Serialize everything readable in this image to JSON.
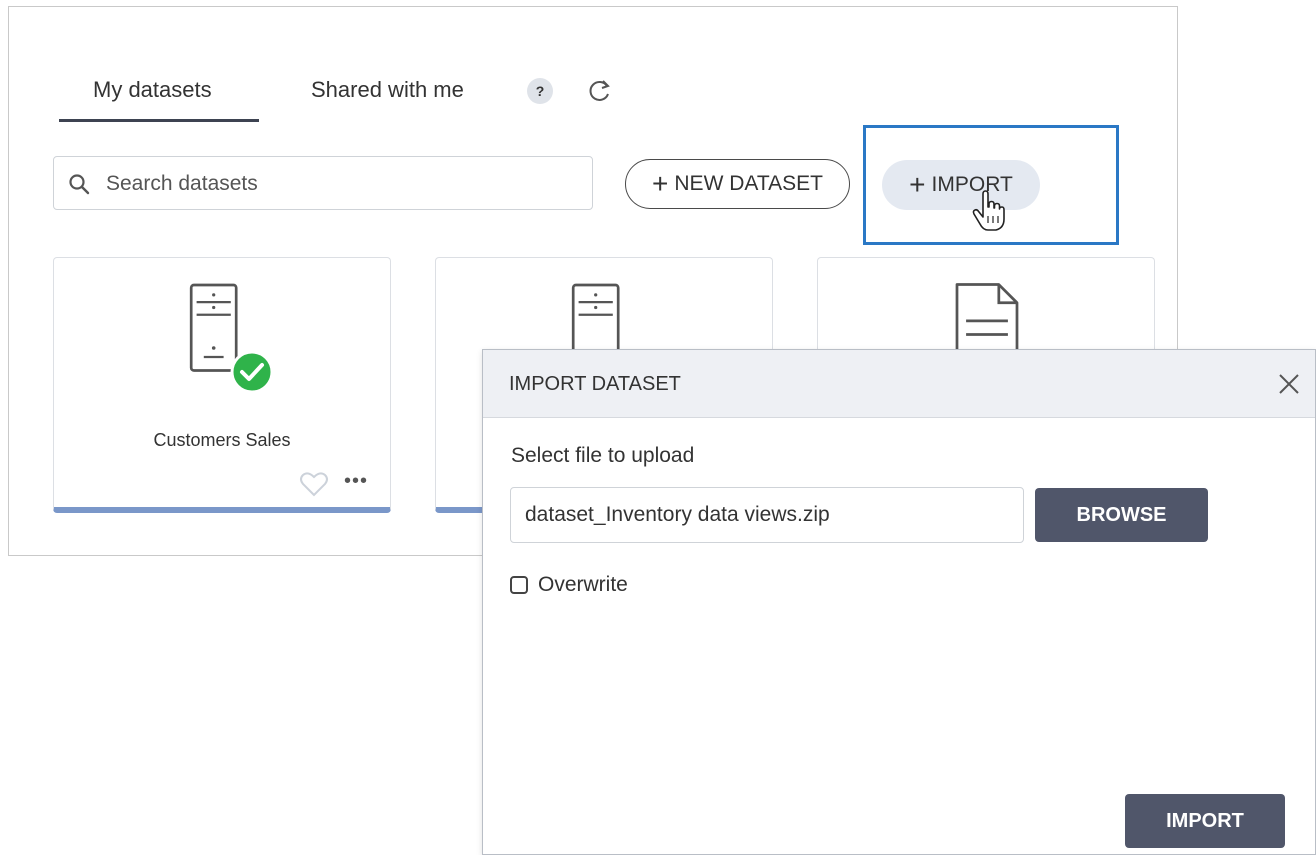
{
  "tabs": {
    "my_datasets": "My datasets",
    "shared_with_me": "Shared with me",
    "help": "?"
  },
  "search": {
    "placeholder": "Search datasets"
  },
  "toolbar": {
    "new_dataset_label": "NEW DATASET",
    "import_label": "IMPORT"
  },
  "cards": [
    {
      "title": "Customers Sales",
      "icon": "database-icon",
      "status": "check-icon"
    },
    {
      "title": "",
      "icon": "database-icon"
    },
    {
      "title": "",
      "icon": "file-icon"
    }
  ],
  "dialog": {
    "title": "IMPORT DATASET",
    "select_label": "Select file to upload",
    "file_value": "dataset_Inventory data views.zip",
    "browse_label": "BROWSE",
    "overwrite_label": "Overwrite",
    "overwrite_checked": false,
    "import_label": "IMPORT"
  },
  "colors": {
    "accent_highlight": "#2a78c5",
    "card_bar": "#7a97c9",
    "primary_button": "#50566a",
    "success": "#2fb34a"
  }
}
